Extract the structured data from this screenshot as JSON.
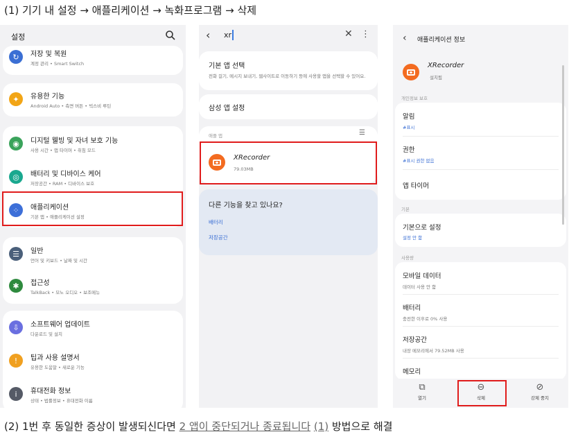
{
  "caption_top": "(1) 기기 내 설정 → 애플리케이션 → 녹화프로그램 → 삭제",
  "caption_bottom": {
    "before": "(2) 1번 후 동일한 증상이 발생되신다면 ",
    "link1": "2 앱이 중단되거나 종료됩니다",
    "space": " ",
    "link2": "(1)",
    "after": " 방법으로 해결"
  },
  "phone1": {
    "title": "설정",
    "items": [
      {
        "title": "저장 및 복원",
        "sub": "계정 관리 • Smart Switch",
        "color": "#3b6fd4",
        "glyph": "↻"
      },
      {
        "title": "유용한 기능",
        "sub": "Android Auto • 측면 버튼 • 빅스비 루틴",
        "color": "#f2a516",
        "glyph": "✦"
      },
      {
        "title": "디지털 웰빙 및 자녀 보호 기능",
        "sub": "사용 시간 • 앱 타이머 • 취침 모드",
        "color": "#3aa35b",
        "glyph": "◉"
      },
      {
        "title": "배터리 및 디바이스 케어",
        "sub": "저장공간 • RAM • 디바이스 보호",
        "color": "#1aa88f",
        "glyph": "◎"
      },
      {
        "title": "애플리케이션",
        "sub": "기본 앱 • 애플리케이션 설정",
        "color": "#3d6fd8",
        "glyph": "⁘"
      },
      {
        "title": "일반",
        "sub": "언어 및 키보드 • 날짜 및 시간",
        "color": "#4a5f7a",
        "glyph": "☰"
      },
      {
        "title": "접근성",
        "sub": "TalkBack • 모노 오디오 • 보조메뉴",
        "color": "#2e8a3e",
        "glyph": "✱"
      },
      {
        "title": "소프트웨어 업데이트",
        "sub": "다운로드 및 설치",
        "color": "#6a6fe0",
        "glyph": "⇩"
      },
      {
        "title": "팁과 사용 설명서",
        "sub": "유용한 도움말 • 새로운 기능",
        "color": "#f0a020",
        "glyph": "!"
      },
      {
        "title": "휴대전화 정보",
        "sub": "상태 • 법률정보 • 휴대전화 이름",
        "color": "#555a66",
        "glyph": "i"
      }
    ]
  },
  "phone2": {
    "query": "xr",
    "default_app_title": "기본 앱 선택",
    "default_app_sub": "전화 걸기, 메시지 보내기, 웹사이트로 이동하기 등에 사용할 앱을 선택할 수 있어요.",
    "samsung_settings": "삼성 앱 설정",
    "section_label": "애플 앱",
    "app_name": "XRecorder",
    "app_size": "79.03MB",
    "suggest_title": "다른 기능을 찾고 있나요?",
    "suggest_links": [
      "배터리",
      "저장공간"
    ]
  },
  "phone3": {
    "title": "애플리케이션 정보",
    "app_name": "XRecorder",
    "app_sub": "설치됨",
    "sections": {
      "privacy": "개인정보 보호",
      "default": "기본",
      "usage": "사용량"
    },
    "privacy_items": [
      {
        "title": "알림",
        "sub": "#표시"
      },
      {
        "title": "권한",
        "sub": "#표시 권한 없음"
      },
      {
        "title": "앱 타이머",
        "sub": ""
      }
    ],
    "default_items": [
      {
        "title": "기본으로 설정",
        "sub": "설정 안 함"
      }
    ],
    "usage_items": [
      {
        "title": "모바일 데이터",
        "sub": "데이터 사용 안 함"
      },
      {
        "title": "배터리",
        "sub": "충전한 이후로 0% 사용"
      },
      {
        "title": "저장공간",
        "sub": "내장 메모리에서 79.52MB 사용"
      },
      {
        "title": "메모리",
        "sub": ""
      }
    ],
    "bottom": {
      "open": "열기",
      "uninstall": "삭제",
      "force_stop": "강제 중지"
    }
  }
}
